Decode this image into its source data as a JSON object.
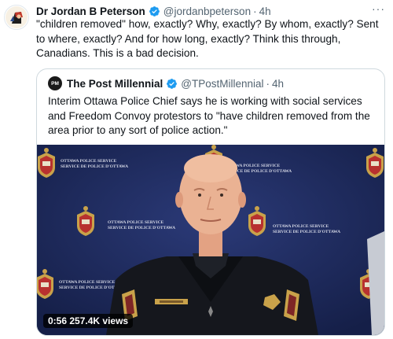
{
  "tweet": {
    "author_name": "Dr Jordan B Peterson",
    "handle": "@jordanbpeterson",
    "separator": "·",
    "time": "4h",
    "more": "···",
    "text": "\"children removed\" how, exactly? Why, exactly? By whom, exactly? Sent to where, exactly? And for how long, exactly? Think this through, Canadians. This is a bad decision."
  },
  "quoted": {
    "avatar_text": "PM",
    "author_name": "The Post Millennial",
    "handle": "@TPostMillennial",
    "separator": "·",
    "time": "4h",
    "text": "Interim Ottawa Police Chief says he is working with social services and Freedom Convoy protestors to \"have children removed from the area prior to any sort of police action.\""
  },
  "video": {
    "duration": "0:56",
    "views": "257.4K views",
    "backdrop_lines": [
      [
        "OTTAWA POLICE SERVICE",
        "SERVICE DE POLICE D'OTTAWA"
      ]
    ]
  },
  "colors": {
    "verified": "#1d9bf0",
    "secondary_text": "#536471",
    "backdrop": "#1d2a5c"
  }
}
